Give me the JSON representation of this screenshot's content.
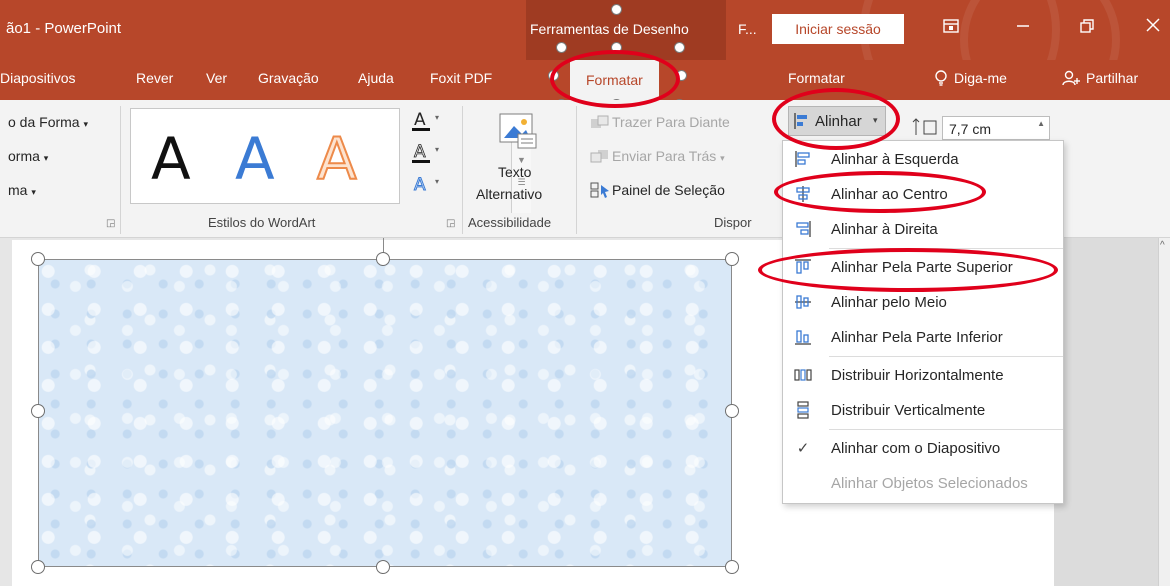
{
  "titlebar": {
    "doc_title": "ão1 - PowerPoint",
    "tools_context": "Ferramentas de Desenho",
    "f_label": "F...",
    "signin": "Iniciar sessão",
    "ribbon_display_icon": "ribbon-display-icon",
    "minimize_icon": "minimize-icon",
    "restore_icon": "restore-icon",
    "close_icon": "close-icon"
  },
  "tabs": {
    "diapositivos": "Diapositivos",
    "rever": "Rever",
    "ver": "Ver",
    "gravacao": "Gravação",
    "ajuda": "Ajuda",
    "foxit": "Foxit PDF",
    "formatar_active": "Formatar",
    "formatar2": "Formatar",
    "diga_me": "Diga-me",
    "partilhar": "Partilhar"
  },
  "ribbon": {
    "forma_preenchimento": "o da Forma",
    "forma_contorno": "orma",
    "forma_efeitos": "ma",
    "wordart_label": "Estilos do WordArt",
    "wordart_letter": "A",
    "texto_alternativo_1": "Texto",
    "texto_alternativo_2": "Alternativo",
    "acessibilidade_label": "Acessibilidade",
    "trazer": "Trazer Para Diante",
    "enviar": "Enviar Para Trás",
    "painel": "Painel de Seleção",
    "dispor_label": "Dispor",
    "alinhar": "Alinhar",
    "size_value": "7,7 cm"
  },
  "menu": {
    "items": [
      {
        "label": "Alinhar à Esquerda",
        "icon": "align-left-icon"
      },
      {
        "label": "Alinhar ao Centro",
        "icon": "align-center-icon"
      },
      {
        "label": "Alinhar à Direita",
        "icon": "align-right-icon"
      },
      {
        "label": "Alinhar Pela Parte Superior",
        "icon": "align-top-icon"
      },
      {
        "label": "Alinhar pelo Meio",
        "icon": "align-middle-icon"
      },
      {
        "label": "Alinhar Pela Parte Inferior",
        "icon": "align-bottom-icon"
      },
      {
        "label": "Distribuir Horizontalmente",
        "icon": "distribute-horizontal-icon"
      },
      {
        "label": "Distribuir Verticalmente",
        "icon": "distribute-vertical-icon"
      },
      {
        "label": "Alinhar com o Diapositivo",
        "icon": "checkmark-icon"
      },
      {
        "label": "Alinhar Objetos Selecionados",
        "icon": ""
      }
    ]
  },
  "colors": {
    "accent": "#b7472a",
    "annotation": "#e0001b",
    "wordart_blue": "#3b7bd4",
    "wordart_orange": "#ed8a4a"
  }
}
